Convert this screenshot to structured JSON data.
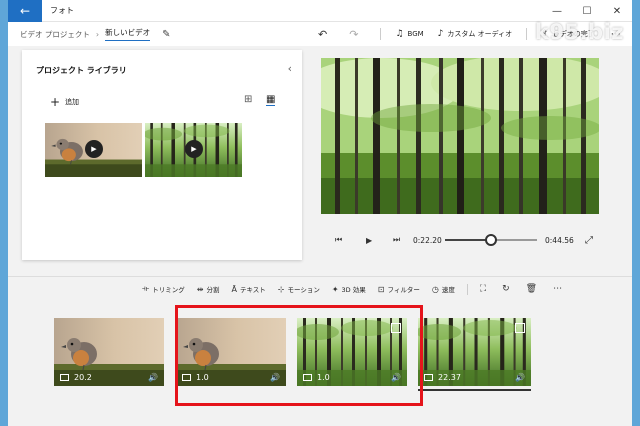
{
  "app": {
    "title": "フォト"
  },
  "watermark": "k95.biz",
  "breadcrumb": {
    "parent": "ビデオ プロジェクト",
    "current": "新しいビデオ"
  },
  "toolbar": {
    "bgm_label": "BGM",
    "custom_audio_label": "カスタム オーディオ",
    "finish_label": "ビデオの完了"
  },
  "library": {
    "title": "プロジェクト ライブラリ",
    "add_label": "追加"
  },
  "player": {
    "current_time": "0:22.20",
    "total_time": "0:44.56",
    "progress": 0.5
  },
  "edit_tools": {
    "trim": "トリミング",
    "split": "分割",
    "text": "テキスト",
    "motion": "モーション",
    "effects_3d": "3D 効果",
    "filter": "フィルター",
    "speed": "速度"
  },
  "storyboard": {
    "clips": [
      {
        "duration": "20.2",
        "scene": "bird"
      },
      {
        "duration": "1.0",
        "scene": "bird"
      },
      {
        "duration": "1.0",
        "scene": "forest"
      },
      {
        "duration": "22.37",
        "scene": "forest"
      }
    ]
  },
  "colors": {
    "accent": "#1f6fc3",
    "highlight": "#e5141b",
    "desktop": "#5fa6d8"
  }
}
